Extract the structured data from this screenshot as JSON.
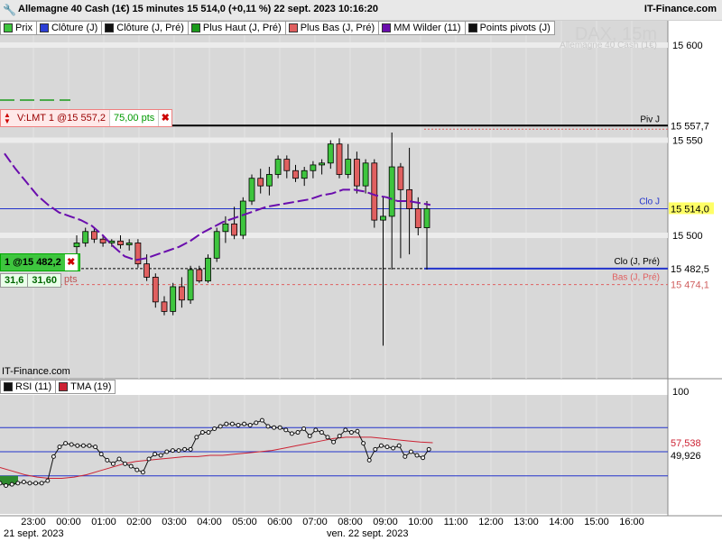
{
  "header": {
    "title": "Allemagne 40 Cash (1€) 15 minutes 15 514,0 (+0,11 %) 22 sept. 2023 10:16:20",
    "site": "IT-Finance.com",
    "wrench_icon": "wrench-icon"
  },
  "legend": [
    {
      "label": "Prix",
      "color": "#3ec53e"
    },
    {
      "label": "Clôture (J)",
      "color": "#2c3fd6"
    },
    {
      "label": "Clôture (J, Pré)",
      "color": "#111111"
    },
    {
      "label": "Plus Haut (J, Pré)",
      "color": "#1a9a1a"
    },
    {
      "label": "Plus Bas (J, Pré)",
      "color": "#e06060"
    },
    {
      "label": "MM Wilder (11)",
      "color": "#6a0dad"
    },
    {
      "label": "Points pivots (J)",
      "color": "#111111"
    }
  ],
  "watermark": {
    "symbol": "DAX, 15m",
    "name": "Allemagne 40 Cash (1€)"
  },
  "price_axis": {
    "ticks": [
      "15 600",
      "15 550",
      "15 500"
    ],
    "tags": [
      {
        "text": "15 557,7",
        "color": "#000000",
        "bg": "#ffffff"
      },
      {
        "text": "15 514,0",
        "color": "#000000",
        "bg": "#ffff66"
      },
      {
        "text": "15 482,5",
        "color": "#000000",
        "bg": "#ffffff"
      },
      {
        "text": "15 474,1",
        "color": "#d06060",
        "bg": "#ffffff"
      }
    ],
    "lines": [
      {
        "label": "Piv J",
        "color": "#000000"
      },
      {
        "label": "Clo J",
        "color": "#2233cc"
      },
      {
        "label": "Clo (J, Pré)",
        "color": "#000000"
      },
      {
        "label": "Bas (J, Pré)",
        "color": "#e06060"
      }
    ]
  },
  "order": {
    "label": "V:LMT  1 @15 557,2",
    "points": "75,00 pts"
  },
  "position": {
    "label": "1 @15 482,2",
    "qty": "31,6",
    "pnl": "31,60",
    "unit": "pts"
  },
  "credit": "IT-Finance.com",
  "rsi_legend": [
    {
      "label": "RSI (11)",
      "color": "#111111"
    },
    {
      "label": "TMA (19)",
      "color": "#cc2233"
    }
  ],
  "rsi_axis": {
    "top": "100",
    "tma_value": "57,538",
    "rsi_value": "49,926"
  },
  "time_axis": [
    "23:00",
    "00:00",
    "01:00",
    "02:00",
    "03:00",
    "04:00",
    "05:00",
    "06:00",
    "07:00",
    "08:00",
    "09:00",
    "10:00",
    "11:00",
    "12:00",
    "13:00",
    "14:00",
    "15:00",
    "16:00"
  ],
  "date_labels": [
    "21 sept. 2023",
    "ven. 22 sept. 2023"
  ],
  "chart_data": {
    "type": "candlestick",
    "price_range": [
      15420,
      15600
    ],
    "rsi_range": [
      0,
      100
    ],
    "candles": [
      [
        15494,
        15500,
        15488,
        15496
      ],
      [
        15496,
        15504,
        15494,
        15502
      ],
      [
        15502,
        15504,
        15496,
        15498
      ],
      [
        15498,
        15500,
        15494,
        15496
      ],
      [
        15496,
        15498,
        15494,
        15497
      ],
      [
        15497,
        15500,
        15493,
        15495
      ],
      [
        15495,
        15498,
        15492,
        15496
      ],
      [
        15496,
        15498,
        15483,
        15485
      ],
      [
        15485,
        15490,
        15476,
        15478
      ],
      [
        15478,
        15480,
        15462,
        15465
      ],
      [
        15465,
        15468,
        15458,
        15460
      ],
      [
        15460,
        15475,
        15458,
        15473
      ],
      [
        15473,
        15478,
        15462,
        15466
      ],
      [
        15466,
        15484,
        15464,
        15482
      ],
      [
        15482,
        15484,
        15475,
        15476
      ],
      [
        15476,
        15490,
        15475,
        15488
      ],
      [
        15488,
        15504,
        15486,
        15502
      ],
      [
        15502,
        15510,
        15496,
        15506
      ],
      [
        15506,
        15515,
        15498,
        15500
      ],
      [
        15500,
        15520,
        15498,
        15518
      ],
      [
        15518,
        15532,
        15516,
        15530
      ],
      [
        15530,
        15535,
        15522,
        15526
      ],
      [
        15526,
        15536,
        15521,
        15532
      ],
      [
        15532,
        15542,
        15530,
        15540
      ],
      [
        15540,
        15542,
        15530,
        15534
      ],
      [
        15534,
        15537,
        15528,
        15530
      ],
      [
        15530,
        15536,
        15526,
        15534
      ],
      [
        15534,
        15539,
        15530,
        15537
      ],
      [
        15537,
        15540,
        15532,
        15538
      ],
      [
        15538,
        15550,
        15535,
        15548
      ],
      [
        15548,
        15551,
        15530,
        15532
      ],
      [
        15532,
        15548,
        15530,
        15540
      ],
      [
        15540,
        15544,
        15522,
        15526
      ],
      [
        15526,
        15540,
        15522,
        15538
      ],
      [
        15538,
        15540,
        15504,
        15508
      ],
      [
        15508,
        15520,
        15442,
        15510
      ],
      [
        15510,
        15554,
        15482,
        15536
      ],
      [
        15536,
        15538,
        15488,
        15524
      ],
      [
        15524,
        15546,
        15490,
        15514
      ],
      [
        15514,
        15520,
        15500,
        15504
      ],
      [
        15504,
        15518,
        15482,
        15514
      ]
    ],
    "wilder_ma": [
      15543,
      15535,
      15528,
      15521,
      15516,
      15512,
      15510,
      15508,
      15505,
      15500,
      15494,
      15489,
      15487,
      15488,
      15490,
      15492,
      15494,
      15497,
      15501,
      15504,
      15507,
      15509,
      15511,
      15513,
      15515,
      15516,
      15517,
      15518,
      15519,
      15521,
      15522,
      15524,
      15524,
      15523,
      15521,
      15520,
      15518,
      15518,
      15517,
      15516
    ],
    "levels": {
      "pivot": 15557.7,
      "close_j": 15514.0,
      "close_prev": 15482.5,
      "low_prev": 15474.1,
      "order_price": 15557.2,
      "position_price": 15482.2
    },
    "rsi_bands": [
      70,
      50,
      30
    ],
    "rsi": [
      24,
      22,
      23,
      24,
      25,
      24,
      24,
      24,
      26,
      46,
      54,
      57,
      56,
      55,
      55,
      55,
      54,
      48,
      43,
      40,
      44,
      40,
      38,
      35,
      33,
      44,
      48,
      47,
      50,
      51,
      51,
      52,
      52,
      62,
      66,
      66,
      69,
      71,
      73,
      73,
      72,
      73,
      72,
      74,
      76,
      71,
      70,
      70,
      68,
      65,
      66,
      69,
      63,
      68,
      66,
      62,
      58,
      63,
      68,
      66,
      67,
      57,
      43,
      52,
      55,
      54,
      53,
      55,
      46,
      50,
      47,
      45,
      52
    ],
    "tma": [
      37,
      34,
      31,
      29,
      28,
      28,
      29,
      31,
      34,
      37,
      40,
      42,
      43,
      44,
      45,
      46,
      46,
      47,
      47,
      48,
      49,
      50,
      51,
      53,
      55,
      57,
      59,
      61,
      62,
      62,
      62,
      61,
      60,
      59,
      58,
      57.5
    ]
  }
}
